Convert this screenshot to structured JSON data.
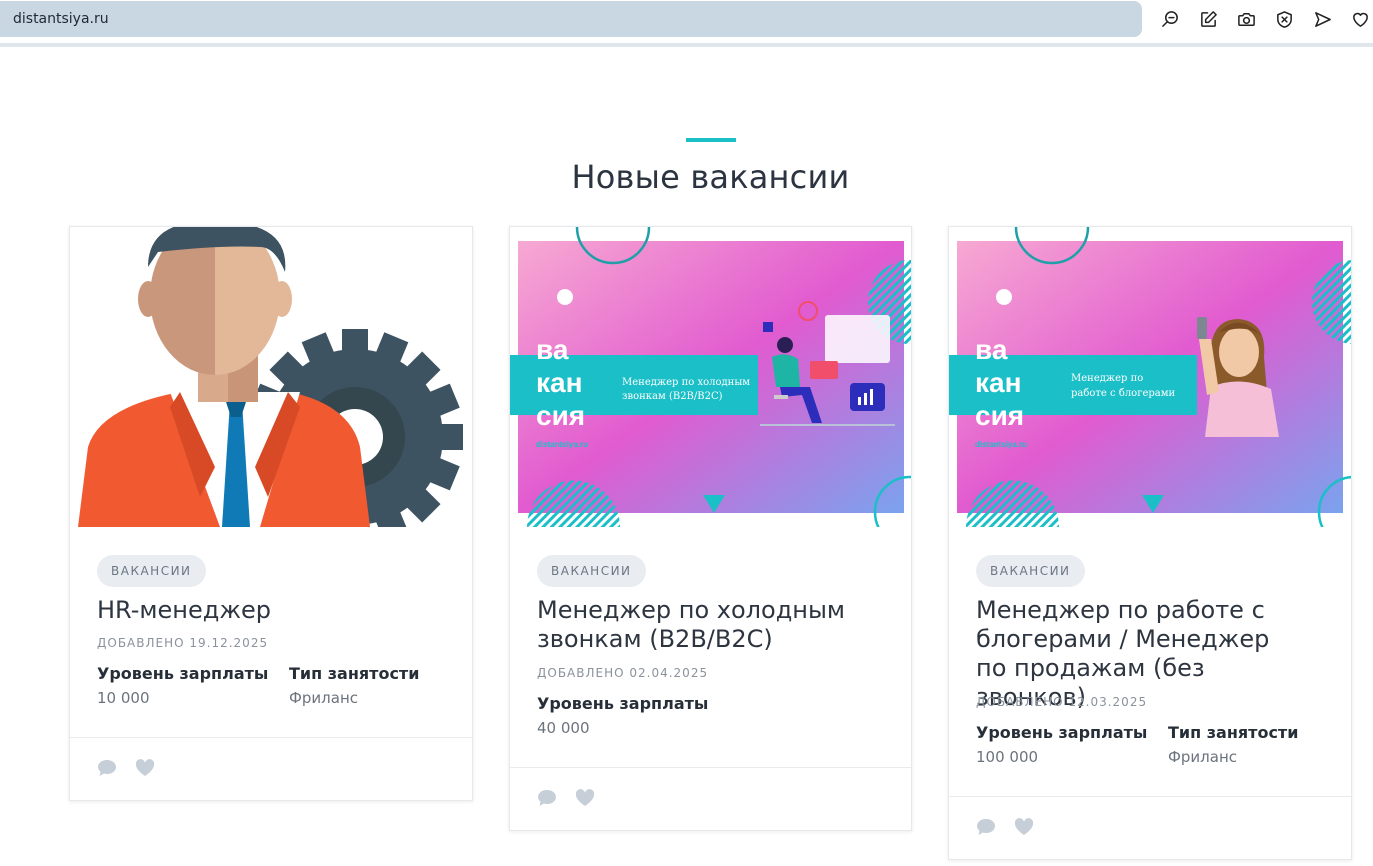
{
  "browser": {
    "url": "distantsiya.ru",
    "toolbar_icons": [
      "zoom-icon",
      "edit-icon",
      "camera-icon",
      "shield-icon",
      "send-icon",
      "heart-icon"
    ]
  },
  "section": {
    "title": "Новые вакансии",
    "accent_color": "#1abfc7"
  },
  "cards": [
    {
      "badge": "ВАКАНСИИ",
      "title": "HR-менеджер",
      "date": "Добавлено 19.12.2025",
      "salary_label": "Уровень зарплаты",
      "salary_value": "10 000",
      "type_label": "Тип занятости",
      "type_value": "Фриланс"
    },
    {
      "badge": "ВАКАНСИИ",
      "title": "Менеджер по холодным звонкам (B2B/B2C)",
      "date": "Добавлено 02.04.2025",
      "salary_label": "Уровень зарплаты",
      "salary_value": "40 000",
      "image_word": "ва кан сия",
      "image_caption": "Менеджер по холодным звонкам (B2B/B2C)",
      "image_site": "distantsiya.ru"
    },
    {
      "badge": "ВАКАНСИИ",
      "title": "Менеджер по работе с блогерами / Менеджер по продажам (без звонков)",
      "date": "Добавлено 12.03.2025",
      "salary_label": "Уровень зарплаты",
      "salary_value": "100 000",
      "type_label": "Тип занятости",
      "type_value": "Фриланс",
      "image_word": "ва кан сия",
      "image_caption": "Менеджер по работе с блогерами",
      "image_site": "distantsiya.ru"
    }
  ]
}
